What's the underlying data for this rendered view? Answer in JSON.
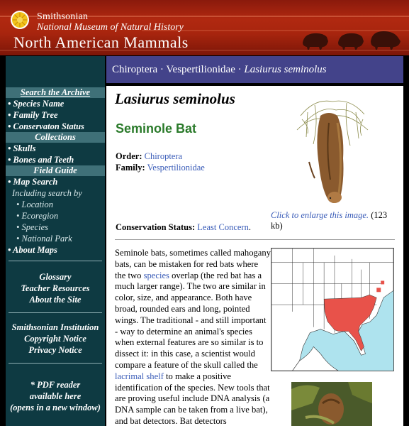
{
  "header": {
    "org": "Smithsonian",
    "museum": "National Museum of Natural History",
    "site_title": "North American Mammals",
    "icons": [
      "smithsonian-sun-logo",
      "muskox-silhouette"
    ]
  },
  "sidebar": {
    "search_head": "Search the Archive",
    "search_items": [
      "• Species Name",
      "• Family Tree",
      "• Conservaton Status"
    ],
    "collections_head": "Collections",
    "collections_items": [
      "• Skulls",
      "• Bones and Teeth"
    ],
    "guide_head": "Field Guide",
    "map_search": "• Map Search",
    "including": "Including search by",
    "including_items": [
      "• Location",
      "• Ecoregion",
      "• Species",
      "• National Park"
    ],
    "about_maps": "• About Maps",
    "links1": [
      "Glossary",
      "Teacher Resources",
      "About the Site"
    ],
    "links2": [
      "Smithsonian Institution",
      "Copyright Notice",
      "Privacy Notice"
    ],
    "pdf_note": [
      "* PDF reader",
      "available here",
      "(opens in a new window)"
    ]
  },
  "taxonomy": {
    "order": "Chiroptera",
    "sep": " · ",
    "family": "Vespertilionidae",
    "species": "Lasiurus seminolus"
  },
  "main": {
    "scientific_name": "Lasiurus seminolus",
    "common_name": "Seminole Bat",
    "order_label": "Order:",
    "order_value": "Chiroptera",
    "family_label": "Family:",
    "family_value": "Vespertilionidae",
    "enlarge_link": "Click to enlarge this image.",
    "enlarge_size": " (123 kb)",
    "conservation_label": "Conservation Status:",
    "conservation_value": "Least Concern",
    "body": [
      "Seminole bats, sometimes called mahogany bats, can be mistaken for red bats where the two ",
      "species",
      " overlap (the red bat has a much larger range). The two are similar in color, size, and appearance. Both have broad, rounded ears and long, pointed wings. The traditional - and still important - way to determine an animal's species when external features are so similar is to dissect it: in this case, a scientist would compare a feature of the skull called the ",
      "lacrimal shelf",
      " to make a positive identification of the species. New tools that are proving useful include DNA analysis (a DNA sample can be taken from a live bat), and bat detectors. Bat detectors"
    ]
  },
  "colors": {
    "header_red": "#a8250e",
    "sidebar_teal": "#0e3a42",
    "sidebar_head": "#3f7078",
    "taxbar": "#43438a",
    "link": "#3a5cb8",
    "common_name_green": "#2a7a2a",
    "range_red": "#e8524a"
  }
}
